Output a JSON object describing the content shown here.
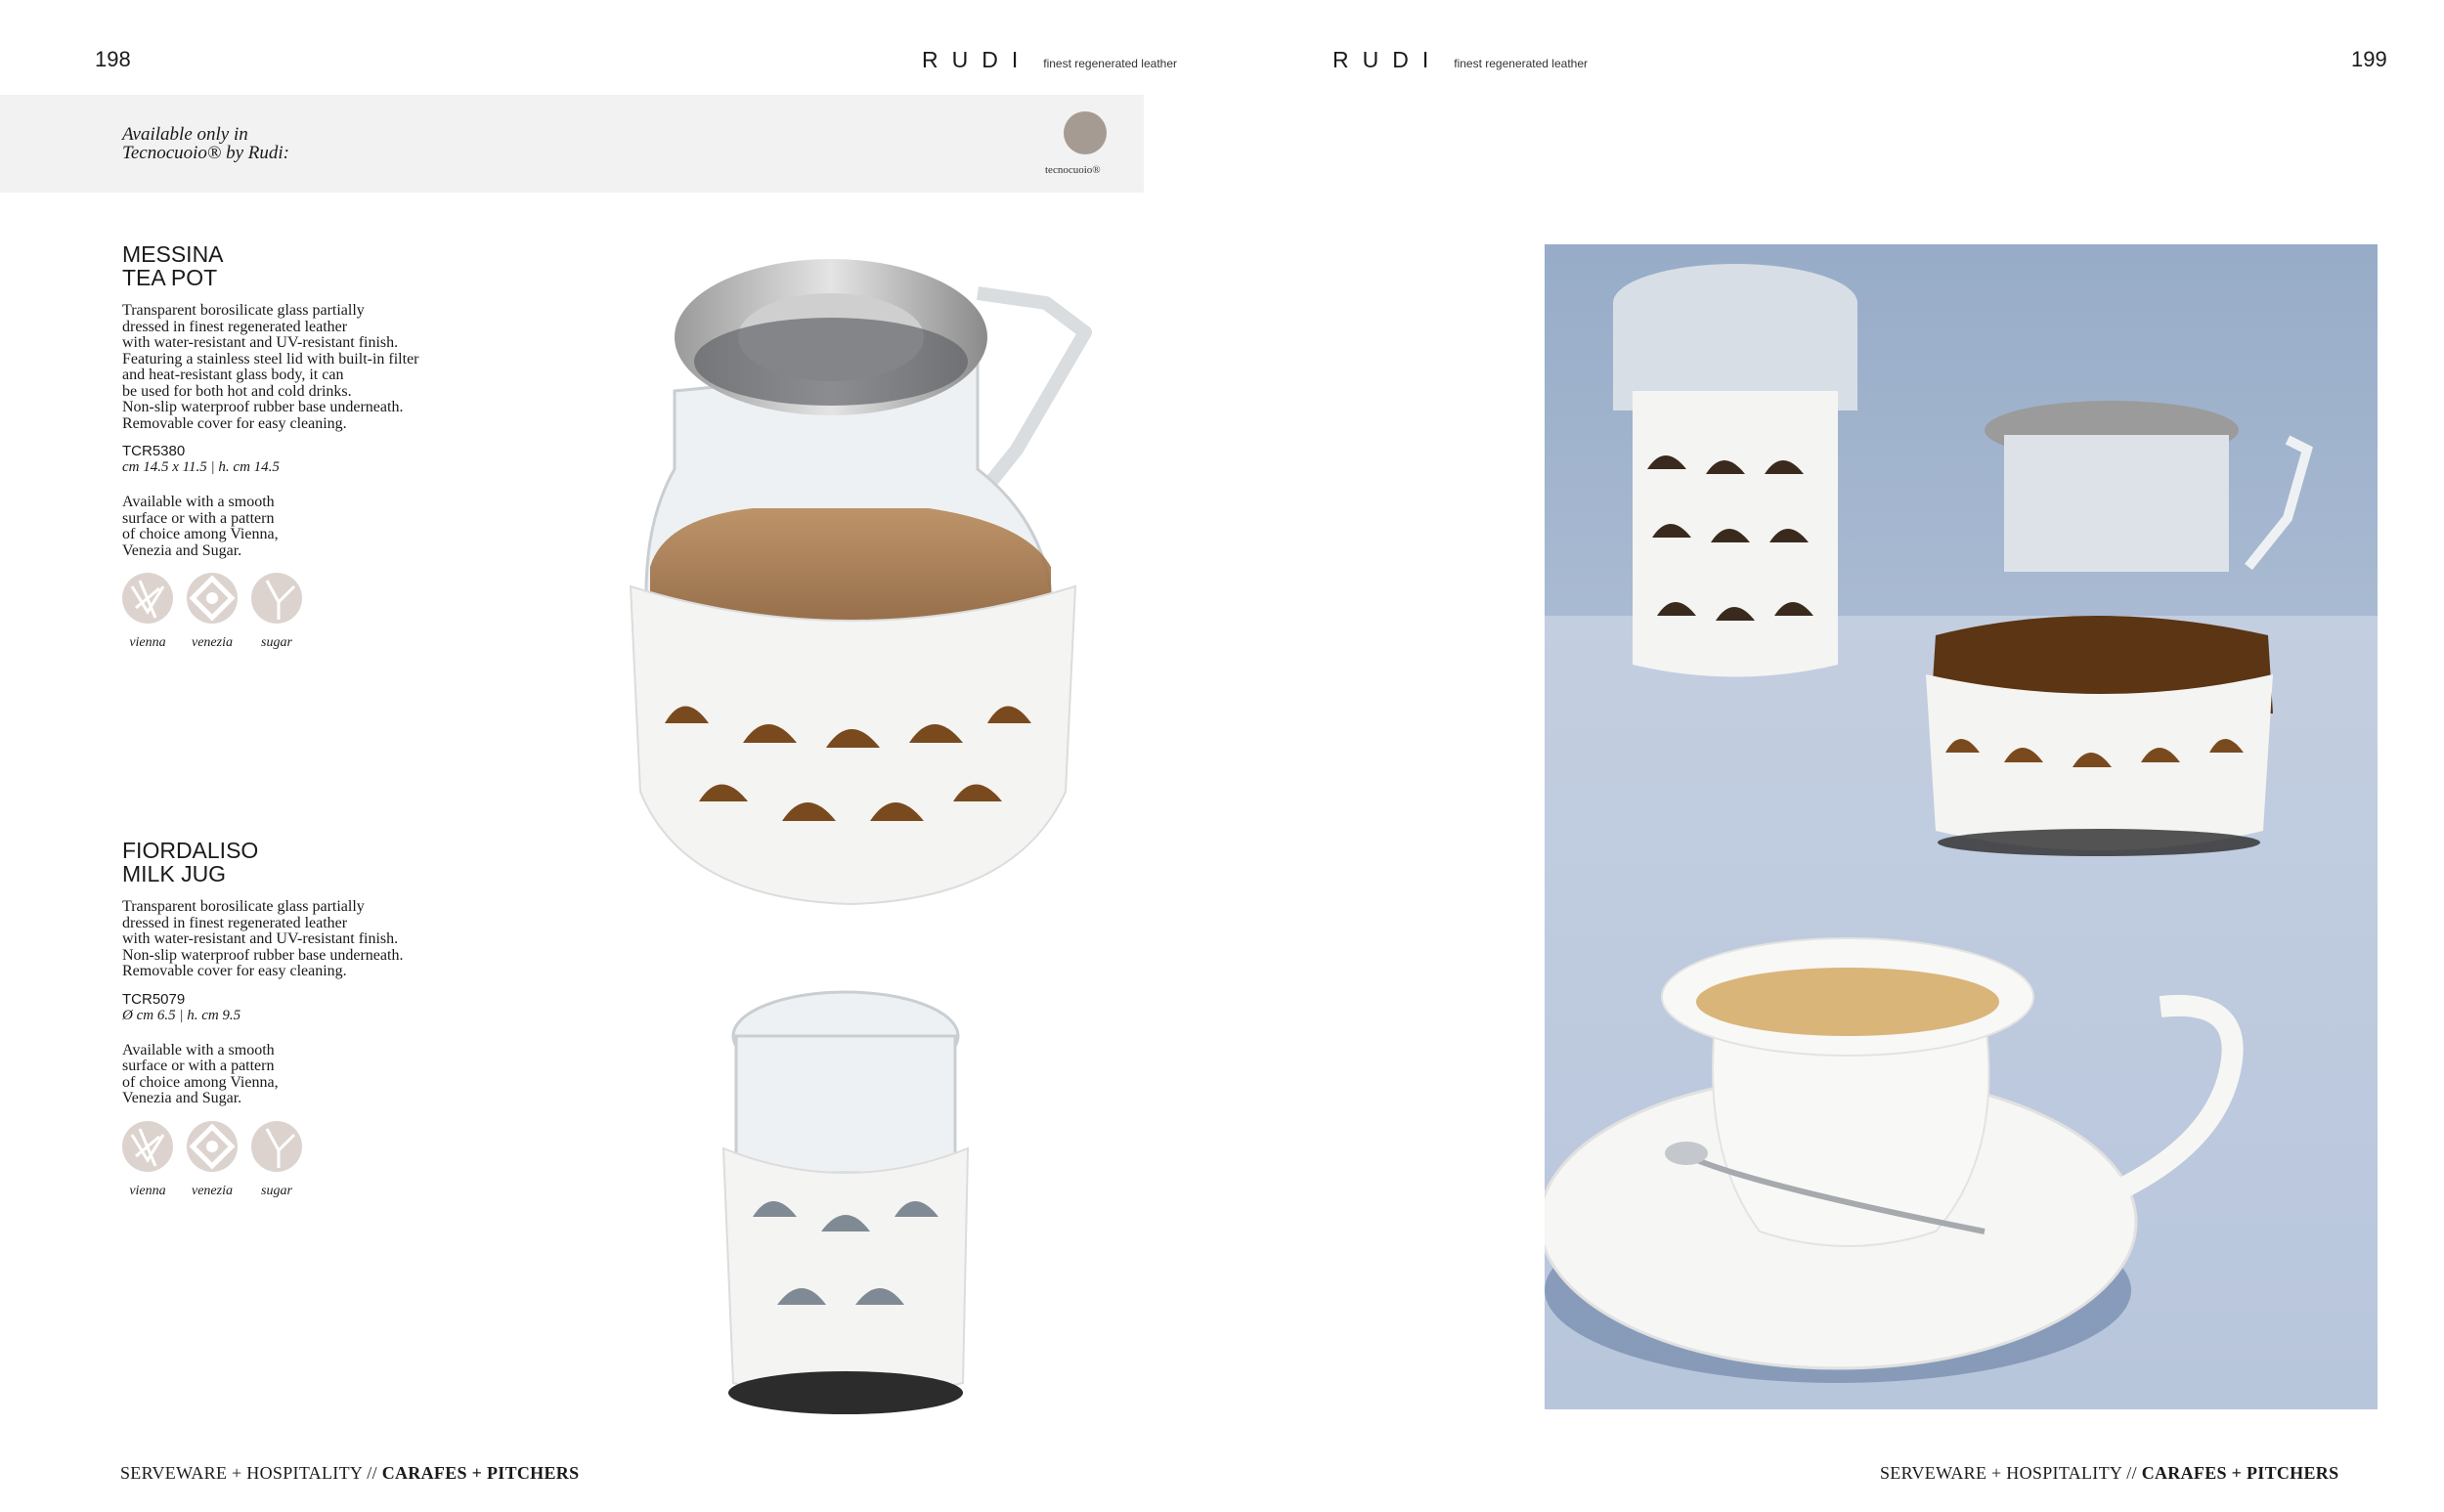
{
  "header": {
    "left_page_number": "198",
    "right_page_number": "199",
    "brand": "RUDI",
    "brand_tagline": "finest regenerated leather"
  },
  "banner": {
    "line1": "Available only in",
    "line2": "Tecnocuoio® by Rudi:",
    "swatch_label": "tecnocuoio®",
    "swatch_color": "#a59b93"
  },
  "products": [
    {
      "title_line1": "MESSINA",
      "title_line2": "TEA POT",
      "description": "Transparent borosilicate glass partially\ndressed in finest regenerated leather\nwith water-resistant and UV-resistant finish.\nFeaturing a stainless steel lid with built-in filter\nand heat-resistant glass body, it can\nbe used for both hot and cold drinks.\nNon-slip waterproof rubber base underneath.\nRemovable cover for easy cleaning.",
      "code": "TCR5380",
      "dimensions": "cm 14.5 x 11.5 | h. cm 14.5",
      "availability": "Available with a smooth\nsurface or with a pattern\nof choice among Vienna,\nVenezia and Sugar.",
      "patterns": [
        "vienna",
        "venezia",
        "sugar"
      ]
    },
    {
      "title_line1": "FIORDALISO",
      "title_line2": "MILK JUG",
      "description": "Transparent borosilicate glass partially\ndressed in finest regenerated leather\nwith water-resistant and UV-resistant finish.\nNon-slip waterproof rubber base underneath.\nRemovable cover for easy cleaning.",
      "code": "TCR5079",
      "dimensions": "Ø cm 6.5 | h. cm 9.5",
      "availability": "Available with a smooth\nsurface or with a pattern\nof choice among Vienna,\nVenezia and Sugar.",
      "patterns": [
        "vienna",
        "venezia",
        "sugar"
      ]
    }
  ],
  "footer": {
    "section": "SERVEWARE + HOSPITALITY // ",
    "subsection": "CARAFES + PITCHERS"
  },
  "colors": {
    "leather_white": "#f4f4f2",
    "tea_amber": "#8a5a2b",
    "photo_wall": "#9db1cb",
    "photo_table": "#c2cde0"
  }
}
